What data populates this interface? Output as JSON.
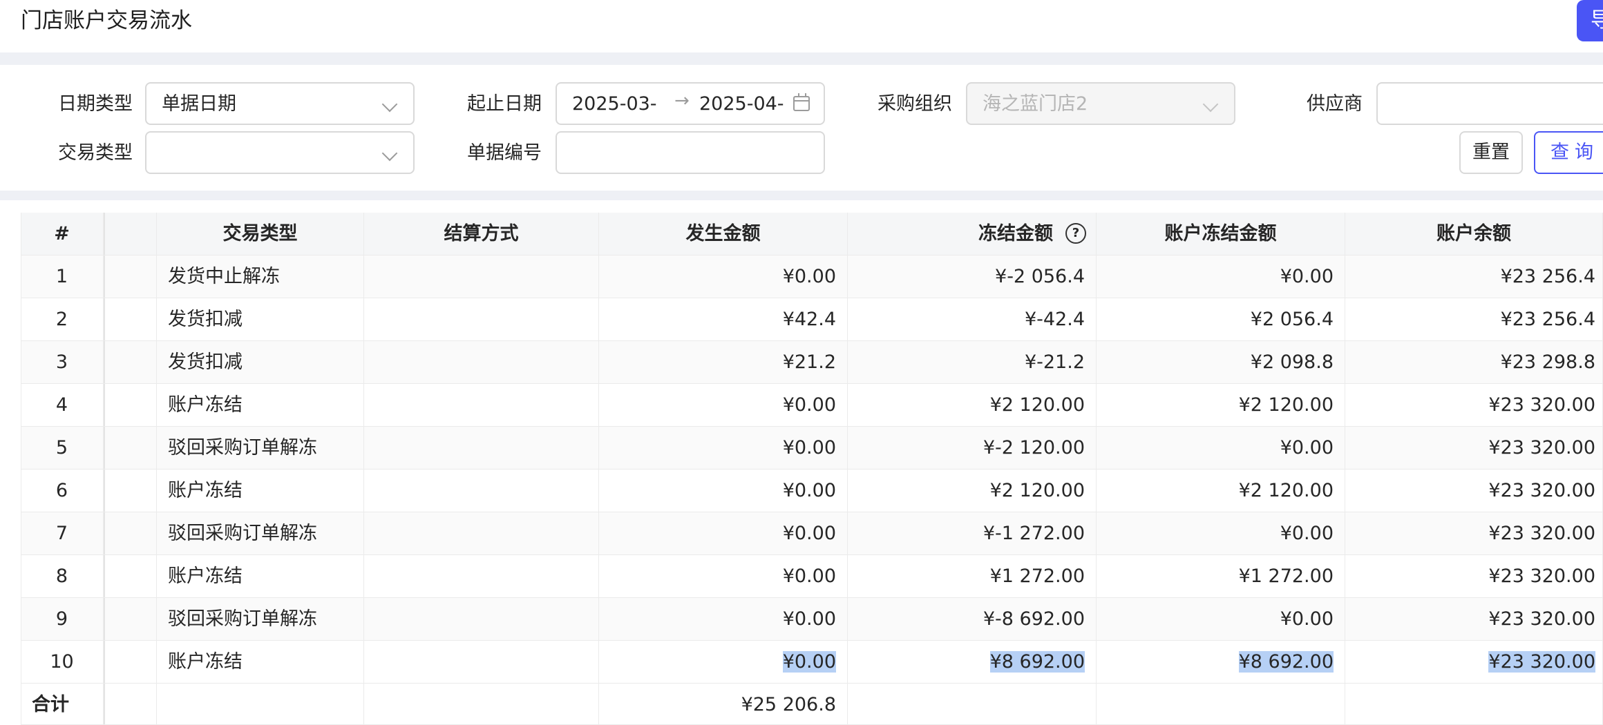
{
  "page_title": "门店账户交易流水",
  "export_label": "导",
  "filters": {
    "date_type": {
      "label": "日期类型",
      "value": "单据日期"
    },
    "date_range": {
      "label": "起止日期",
      "start": "2025-03-",
      "end": "2025-04-",
      "separator": "→"
    },
    "purchase_org": {
      "label": "采购组织",
      "value": "海之蓝门店2"
    },
    "supplier": {
      "label": "供应商",
      "value": ""
    },
    "trade_type": {
      "label": "交易类型",
      "value": ""
    },
    "doc_no": {
      "label": "单据编号",
      "value": ""
    },
    "reset_label": "重置",
    "query_label": "查询"
  },
  "table": {
    "columns": [
      "#",
      "",
      "交易类型",
      "结算方式",
      "发生金额",
      "冻结金额",
      "账户冻结金额",
      "账户余额"
    ],
    "rows": [
      {
        "no": "1",
        "type": "发货中止解冻",
        "settle": "",
        "amount": "¥0.00",
        "frozen": "¥-2 056.4",
        "acct_frozen": "¥0.00",
        "balance": "¥23 256.4"
      },
      {
        "no": "2",
        "type": "发货扣减",
        "settle": "",
        "amount": "¥42.4",
        "frozen": "¥-42.4",
        "acct_frozen": "¥2 056.4",
        "balance": "¥23 256.4"
      },
      {
        "no": "3",
        "type": "发货扣减",
        "settle": "",
        "amount": "¥21.2",
        "frozen": "¥-21.2",
        "acct_frozen": "¥2 098.8",
        "balance": "¥23 298.8"
      },
      {
        "no": "4",
        "type": "账户冻结",
        "settle": "",
        "amount": "¥0.00",
        "frozen": "¥2 120.00",
        "acct_frozen": "¥2 120.00",
        "balance": "¥23 320.00"
      },
      {
        "no": "5",
        "type": "驳回采购订单解冻",
        "settle": "",
        "amount": "¥0.00",
        "frozen": "¥-2 120.00",
        "acct_frozen": "¥0.00",
        "balance": "¥23 320.00"
      },
      {
        "no": "6",
        "type": "账户冻结",
        "settle": "",
        "amount": "¥0.00",
        "frozen": "¥2 120.00",
        "acct_frozen": "¥2 120.00",
        "balance": "¥23 320.00"
      },
      {
        "no": "7",
        "type": "驳回采购订单解冻",
        "settle": "",
        "amount": "¥0.00",
        "frozen": "¥-1 272.00",
        "acct_frozen": "¥0.00",
        "balance": "¥23 320.00"
      },
      {
        "no": "8",
        "type": "账户冻结",
        "settle": "",
        "amount": "¥0.00",
        "frozen": "¥1 272.00",
        "acct_frozen": "¥1 272.00",
        "balance": "¥23 320.00"
      },
      {
        "no": "9",
        "type": "驳回采购订单解冻",
        "settle": "",
        "amount": "¥0.00",
        "frozen": "¥-8 692.00",
        "acct_frozen": "¥0.00",
        "balance": "¥23 320.00"
      },
      {
        "no": "10",
        "type": "账户冻结",
        "settle": "",
        "amount": "¥0.00",
        "frozen": "¥8 692.00",
        "acct_frozen": "¥8 692.00",
        "balance": "¥23 320.00"
      }
    ],
    "total": {
      "label": "合计",
      "amount": "¥25 206.8"
    }
  },
  "colors": {
    "accent": "#4a55f5",
    "selection": "#b6d0f5",
    "band": "#eef0f5"
  }
}
